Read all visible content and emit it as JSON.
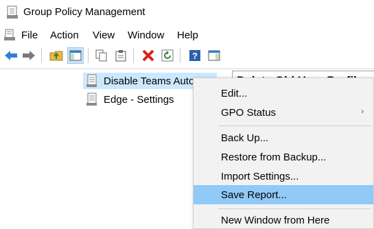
{
  "window": {
    "title": "Group Policy Management"
  },
  "menubar": {
    "items": [
      "File",
      "Action",
      "View",
      "Window",
      "Help"
    ]
  },
  "toolbar": {
    "buttons": [
      "back-arrow-icon",
      "forward-arrow-icon",
      "up-folder-icon",
      "show-hide-tree-icon",
      "copy-icon",
      "paste-icon",
      "delete-icon",
      "refresh-icon",
      "help-icon",
      "show-hide-action-pane-icon"
    ]
  },
  "tree": {
    "items": [
      {
        "label": "Disable Teams AutoStart",
        "selected": true
      },
      {
        "label": "Edge - Settings",
        "selected": false
      }
    ]
  },
  "right_pane": {
    "title": "Delete Old User Profiles"
  },
  "context_menu": {
    "items": [
      {
        "label": "Edit..."
      },
      {
        "label": "GPO Status",
        "submenu": true
      },
      {
        "label": "Back Up..."
      },
      {
        "label": "Restore from Backup..."
      },
      {
        "label": "Import Settings..."
      },
      {
        "label": "Save Report...",
        "highlighted": true
      },
      {
        "label": "New Window from Here"
      }
    ]
  },
  "colors": {
    "selection": "#cce8ff",
    "menu_highlight": "#91c9f7",
    "menu_background": "#f2f2f2"
  }
}
